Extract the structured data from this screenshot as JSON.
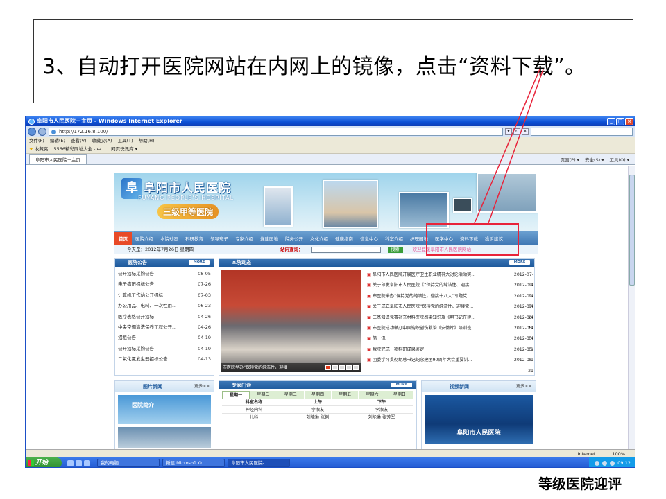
{
  "instruction": "3、自动打开医院网站在内网上的镜像，点击“资料下载”。",
  "footer_caption": "等级医院迎评",
  "window": {
    "title": "阜阳市人民医院－主页 - Windows Internet Explorer",
    "min": "_",
    "max": "□",
    "close": "×",
    "address": "http://172.16.8.100/",
    "menu": [
      "文件(F)",
      "编辑(E)",
      "查看(V)",
      "收藏夹(A)",
      "工具(T)",
      "帮助(H)"
    ],
    "favorites": [
      "收藏夹",
      "5566精彩网址大全 - 中...",
      "网页快讯库 ▾"
    ],
    "tab_title": "阜阳市人民医院－主页",
    "tab_tools": [
      "页面(P) ▾",
      "安全(S) ▾",
      "工具(O) ▾"
    ],
    "status_zone": "Internet",
    "zoom": "100%"
  },
  "taskbar": {
    "start": "开始",
    "tasks": [
      "我的电脑",
      "新建 Microsoft O...",
      "阜阳市人民医院-..."
    ],
    "clock": "09:12"
  },
  "site": {
    "logo_glyph": "阜",
    "name": "阜阳市人民医院",
    "name_en": "FUYANG PEOPLE'S HOSPITAL",
    "grade": "三级甲等医院",
    "nav": [
      "首页",
      "医院介绍",
      "本院动态",
      "科研教育",
      "领导班子",
      "专家介绍",
      "党建园地",
      "院务公开",
      "文化介绍",
      "健康指南",
      "信息中心",
      "科室介绍",
      "护理园地",
      "医学中心",
      "资料下载",
      "投诉建议"
    ],
    "date": "今天是：2012年7月26日 星期四",
    "search_label": "站内查询：",
    "search_btn": "搜索",
    "welcome": "欢迎登录阜阳市人民医院网站！",
    "more": "MORE",
    "notice_title": "医院公告",
    "notices": [
      {
        "t": "公开招标采购公告",
        "d": "08-05"
      },
      {
        "t": "电子病历招标公告",
        "d": "07-26"
      },
      {
        "t": "计算机工作站公开招标",
        "d": "07-03"
      },
      {
        "t": "办公用品、电料、一次性用...",
        "d": "06-23"
      },
      {
        "t": "医疗表格公开招标",
        "d": "04-26"
      },
      {
        "t": "中央空调清洗保养工程公开...",
        "d": "04-26"
      },
      {
        "t": "招租公告",
        "d": "04-19"
      },
      {
        "t": "公开招标采购公告",
        "d": "04-19"
      },
      {
        "t": "二氧化氯发生器招标公告",
        "d": "04-13"
      }
    ],
    "news_title": "本院动态",
    "news_caption": "市医院举办“保持党的纯洁性，迎接",
    "news": [
      {
        "t": "阜阳市人民医院开展医疗卫生职业精神大讨论活动实...",
        "d": "2012-07-24"
      },
      {
        "t": "关于印发阜阳市人民医院《“保持党的纯洁性、迎接...",
        "d": "2012-07-24"
      },
      {
        "t": "市医院举办“保持党的纯洁性，迎接十八大”专题党...",
        "d": "2012-07-24"
      },
      {
        "t": "关于成立阜阳市人民医院“保持党的纯洁性、迎接党...",
        "d": "2012-07-24"
      },
      {
        "t": "三基知识竞赛补充材料医院感染知识及《明书记在建...",
        "d": "2012-06-14"
      },
      {
        "t": "市医院成功举办中国钩织创伤救治《安徽片》培训班",
        "d": "2012-05-24"
      },
      {
        "t": "简　讯",
        "d": "2012-05-21"
      },
      {
        "t": "我院完成一项科研成果鉴定",
        "d": "2012-05-21"
      },
      {
        "t": "团委学习贯彻胡总书记纪念建团90周年大会重要讲...",
        "d": "2012-05-21"
      }
    ],
    "photo_title": "图片新闻",
    "photo_more": "更多>>",
    "photo_label": "医院简介",
    "expert_title": "专家门诊",
    "days": [
      "星期一",
      "星期二",
      "星期三",
      "星期四",
      "星期五",
      "星期六",
      "星期日"
    ],
    "sched_head": [
      "科室名称",
      "上午",
      "下午"
    ],
    "sched_rows": [
      [
        "神经内科",
        "李淑友",
        "李淑友"
      ],
      [
        "儿科",
        "刘能琳 张俐",
        "刘能琳 张芳军"
      ]
    ],
    "video_title": "视频新闻",
    "video_more": "更多>>",
    "video_label": "阜阳市人民医院"
  }
}
